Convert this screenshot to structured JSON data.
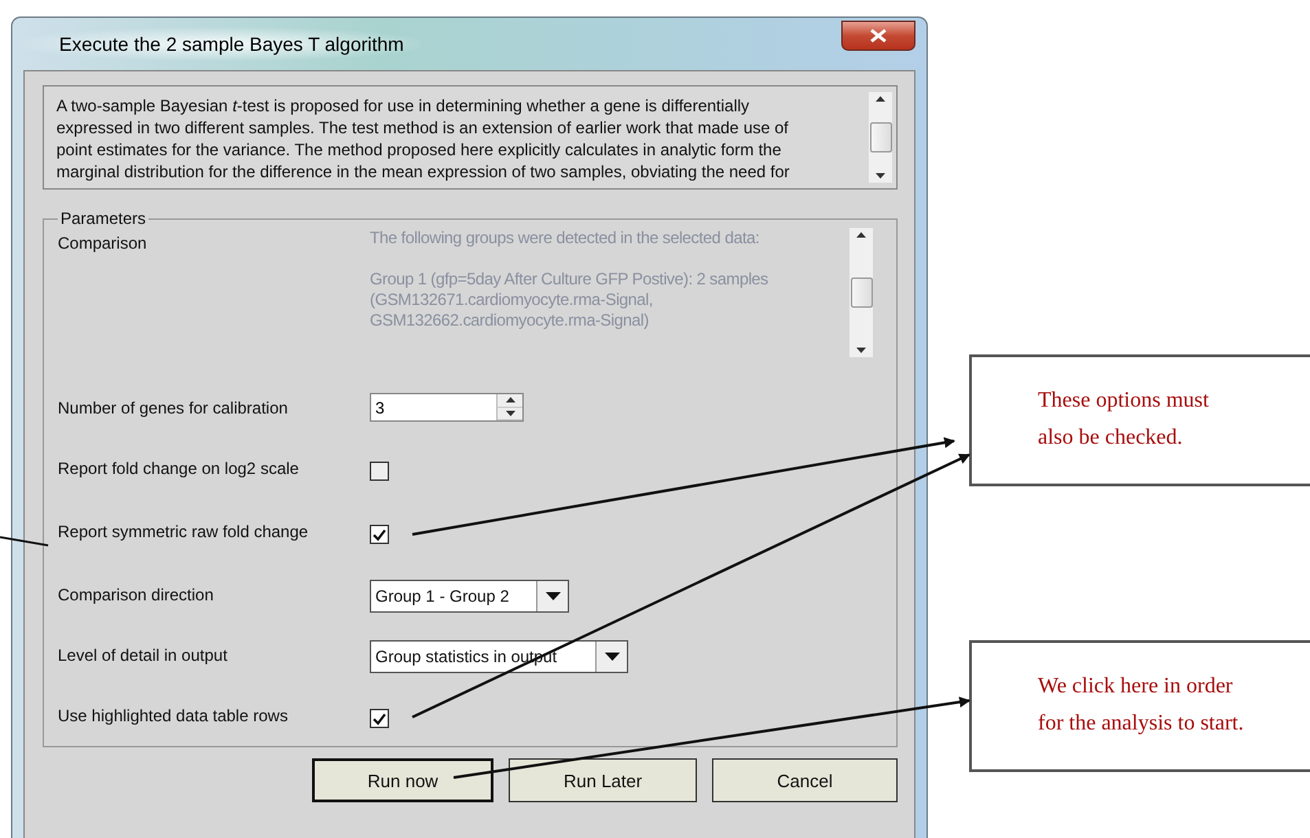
{
  "window": {
    "title": "Execute the 2 sample Bayes T algorithm"
  },
  "description": {
    "lines": [
      "A two-sample Bayesian *t*-test is proposed for use in determining whether a gene is differentially",
      "expressed in two different samples. The test method is an extension of earlier work that made use of",
      "point estimates for the variance. The method proposed here explicitly calculates in analytic form the",
      "marginal distribution for the difference in the mean expression of two samples, obviating the need for"
    ]
  },
  "parameters": {
    "legend": "Parameters",
    "rows": [
      {
        "kind": "list",
        "label": "Comparison",
        "paragraphs": [
          [
            "The following groups were detected in the selected data:"
          ],
          [
            "Group 1 (gfp=5day After Culture GFP Postive): 2 samples",
            "(GSM132671.cardiomyocyte.rma-Signal,",
            "GSM132662.cardiomyocyte.rma-Signal)"
          ]
        ]
      },
      {
        "kind": "spinner",
        "label": "Number of genes for calibration",
        "value": "3"
      },
      {
        "kind": "checkbox",
        "label": "Report fold change on log2 scale",
        "checked": false
      },
      {
        "kind": "checkbox",
        "label": "Report symmetric raw fold change",
        "checked": true
      },
      {
        "kind": "dropdown",
        "label": "Comparison direction",
        "value": "Group 1 - Group 2"
      },
      {
        "kind": "dropdown",
        "label": "Level of detail in output",
        "value": "Group statistics in output"
      },
      {
        "kind": "checkbox",
        "label": "Use highlighted data table rows",
        "checked": true
      }
    ]
  },
  "buttons": [
    {
      "label": "Run now",
      "default": true
    },
    {
      "label": "Run Later",
      "default": false
    },
    {
      "label": "Cancel",
      "default": false
    }
  ],
  "callouts": [
    {
      "lines": [
        "These options must",
        "also be checked."
      ]
    },
    {
      "lines": [
        "We click here in order",
        "for the analysis to start."
      ]
    }
  ]
}
